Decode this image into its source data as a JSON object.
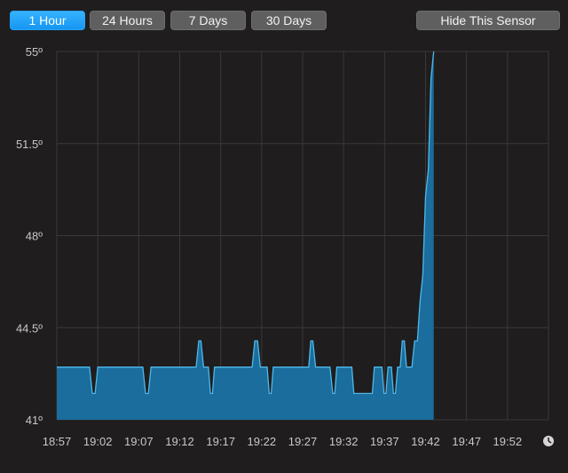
{
  "toolbar": {
    "ranges": [
      {
        "label": "1 Hour",
        "active": true
      },
      {
        "label": "24 Hours",
        "active": false
      },
      {
        "label": "7 Days",
        "active": false
      },
      {
        "label": "30 Days",
        "active": false
      }
    ],
    "hide_label": "Hide This Sensor"
  },
  "icons": {
    "clock": "clock-icon"
  },
  "colors": {
    "accent": "#1a9cf4",
    "fill": "#1a6d9c",
    "line": "#4fb8ea",
    "background": "#1f1d1e"
  },
  "chart_data": {
    "type": "area",
    "title": "",
    "xlabel": "",
    "ylabel": "",
    "ylim": [
      41,
      55
    ],
    "yticks": [
      41,
      44.5,
      48,
      51.5,
      55
    ],
    "ytick_labels": [
      "41º",
      "44.5º",
      "48º",
      "51.5º",
      "55º"
    ],
    "xlim": [
      "18:57",
      "19:57"
    ],
    "xtick_labels": [
      "18:57",
      "19:02",
      "19:07",
      "19:12",
      "19:17",
      "19:22",
      "19:27",
      "19:32",
      "19:37",
      "19:42",
      "19:47",
      "19:52"
    ],
    "grid": true,
    "series": [
      {
        "points": [
          [
            "18:57:00",
            43.0
          ],
          [
            "19:01:00",
            43.0
          ],
          [
            "19:01:20",
            42.0
          ],
          [
            "19:01:40",
            42.0
          ],
          [
            "19:02:00",
            43.0
          ],
          [
            "19:07:30",
            43.0
          ],
          [
            "19:07:50",
            42.0
          ],
          [
            "19:08:10",
            42.0
          ],
          [
            "19:08:30",
            43.0
          ],
          [
            "19:14:00",
            43.0
          ],
          [
            "19:14:20",
            44.0
          ],
          [
            "19:14:35",
            44.0
          ],
          [
            "19:14:55",
            43.0
          ],
          [
            "19:15:30",
            43.0
          ],
          [
            "19:15:45",
            42.0
          ],
          [
            "19:16:00",
            42.0
          ],
          [
            "19:16:15",
            43.0
          ],
          [
            "19:20:50",
            43.0
          ],
          [
            "19:21:10",
            44.0
          ],
          [
            "19:21:30",
            44.0
          ],
          [
            "19:21:50",
            43.0
          ],
          [
            "19:22:40",
            43.0
          ],
          [
            "19:22:55",
            42.0
          ],
          [
            "19:23:10",
            42.0
          ],
          [
            "19:23:25",
            43.0
          ],
          [
            "19:27:45",
            43.0
          ],
          [
            "19:28:00",
            44.0
          ],
          [
            "19:28:15",
            44.0
          ],
          [
            "19:28:35",
            43.0
          ],
          [
            "19:30:20",
            43.0
          ],
          [
            "19:30:40",
            42.0
          ],
          [
            "19:30:55",
            42.0
          ],
          [
            "19:31:10",
            43.0
          ],
          [
            "19:33:00",
            43.0
          ],
          [
            "19:33:15",
            42.0
          ],
          [
            "19:35:30",
            42.0
          ],
          [
            "19:35:45",
            43.0
          ],
          [
            "19:36:40",
            43.0
          ],
          [
            "19:36:55",
            42.0
          ],
          [
            "19:37:10",
            42.0
          ],
          [
            "19:37:25",
            43.0
          ],
          [
            "19:37:50",
            43.0
          ],
          [
            "19:38:05",
            42.0
          ],
          [
            "19:38:20",
            42.0
          ],
          [
            "19:38:35",
            43.0
          ],
          [
            "19:38:55",
            43.0
          ],
          [
            "19:39:10",
            44.0
          ],
          [
            "19:39:25",
            44.0
          ],
          [
            "19:39:40",
            43.0
          ],
          [
            "19:40:20",
            43.0
          ],
          [
            "19:40:40",
            44.0
          ],
          [
            "19:41:00",
            44.0
          ],
          [
            "19:41:20",
            45.5
          ],
          [
            "19:41:40",
            46.5
          ],
          [
            "19:42:00",
            49.5
          ],
          [
            "19:42:20",
            50.5
          ],
          [
            "19:42:40",
            54.0
          ],
          [
            "19:43:00",
            55.0
          ]
        ]
      }
    ]
  }
}
